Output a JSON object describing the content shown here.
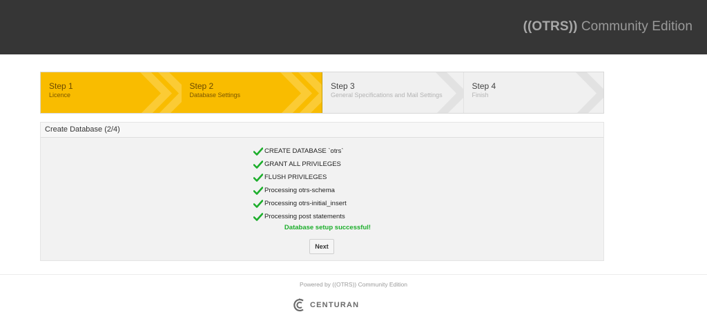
{
  "header": {
    "brand_mark": "((OTRS))",
    "brand_text": "Community Edition"
  },
  "steps": [
    {
      "number": "Step 1",
      "label": "Licence",
      "state": "done"
    },
    {
      "number": "Step 2",
      "label": "Database Settings",
      "state": "active"
    },
    {
      "number": "Step 3",
      "label": "General Specifications and Mail Settings",
      "state": "pending"
    },
    {
      "number": "Step 4",
      "label": "Finish",
      "state": "pending"
    }
  ],
  "panel": {
    "title": "Create Database (2/4)",
    "items": [
      "CREATE DATABASE `otrs`",
      "GRANT ALL PRIVILEGES",
      "FLUSH PRIVILEGES",
      "Processing otrs-schema",
      "Processing otrs-initial_insert",
      "Processing post statements"
    ],
    "success": "Database setup successful!",
    "next_label": "Next"
  },
  "footer": {
    "powered_by": "Powered by ((OTRS)) Community Edition",
    "logo_text": "CENTURAN"
  },
  "colors": {
    "header_bg": "#363636",
    "step_active": "#f9bc00",
    "step_inactive": "#f0f0f0",
    "check": "#1cae2b",
    "success": "#1cae2b"
  }
}
